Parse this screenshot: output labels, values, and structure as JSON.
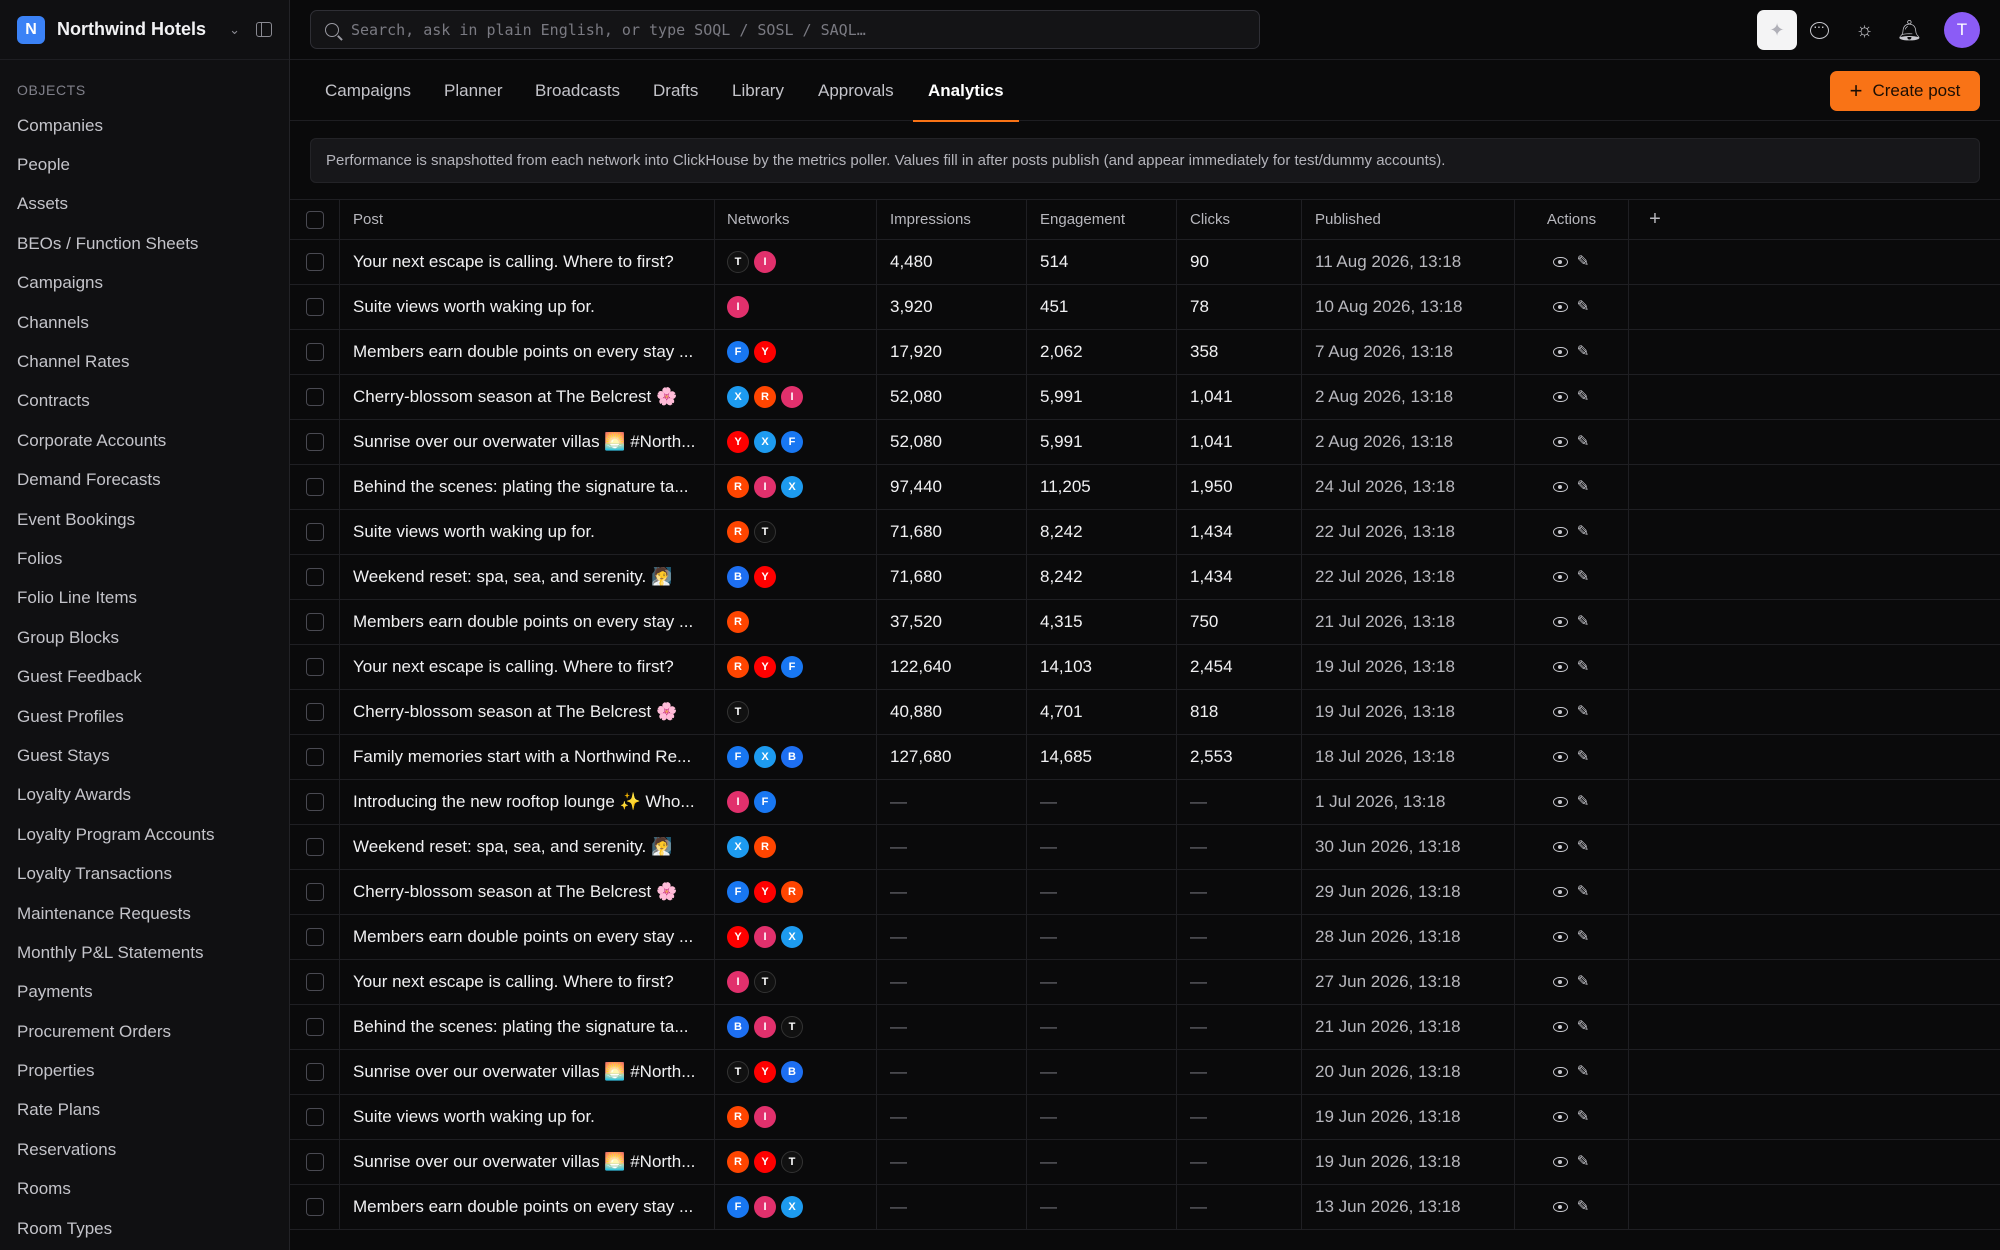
{
  "app": {
    "logo_letter": "N",
    "name": "Northwind Hotels"
  },
  "sidebar": {
    "section_label": "OBJECTS",
    "items": [
      "Companies",
      "People",
      "Assets",
      "BEOs / Function Sheets",
      "Campaigns",
      "Channels",
      "Channel Rates",
      "Contracts",
      "Corporate Accounts",
      "Demand Forecasts",
      "Event Bookings",
      "Folios",
      "Folio Line Items",
      "Group Blocks",
      "Guest Feedback",
      "Guest Profiles",
      "Guest Stays",
      "Loyalty Awards",
      "Loyalty Program Accounts",
      "Loyalty Transactions",
      "Maintenance Requests",
      "Monthly P&L Statements",
      "Payments",
      "Procurement Orders",
      "Properties",
      "Rate Plans",
      "Reservations",
      "Rooms",
      "Room Types"
    ]
  },
  "search": {
    "placeholder": "Search, ask in plain English, or type SOQL / SOSL / SAQL…"
  },
  "user": {
    "avatar_letter": "T"
  },
  "tabs": [
    "Campaigns",
    "Planner",
    "Broadcasts",
    "Drafts",
    "Library",
    "Approvals",
    "Analytics"
  ],
  "active_tab": "Analytics",
  "create_button": "Create post",
  "info_text": "Performance is snapshotted from each network into ClickHouse by the metrics poller. Values fill in after posts publish (and appear immediately for test/dummy accounts).",
  "columns": {
    "post": "Post",
    "networks": "Networks",
    "impressions": "Impressions",
    "engagement": "Engagement",
    "clicks": "Clicks",
    "published": "Published",
    "actions": "Actions",
    "add": "+"
  },
  "network_colors": {
    "T": "#111111",
    "I": "#e1306c",
    "F": "#1877f2",
    "Y": "#ff0000",
    "X": "#1d9bf0",
    "R": "#ff4500",
    "B": "#1d6ff2"
  },
  "rows": [
    {
      "post": "Your next escape is calling. Where to first?",
      "networks": [
        "T",
        "I"
      ],
      "impressions": "4,480",
      "engagement": "514",
      "clicks": "90",
      "published": "11 Aug 2026, 13:18"
    },
    {
      "post": "Suite views worth waking up for.",
      "networks": [
        "I"
      ],
      "impressions": "3,920",
      "engagement": "451",
      "clicks": "78",
      "published": "10 Aug 2026, 13:18"
    },
    {
      "post": "Members earn double points on every stay ...",
      "networks": [
        "F",
        "Y"
      ],
      "impressions": "17,920",
      "engagement": "2,062",
      "clicks": "358",
      "published": "7 Aug 2026, 13:18"
    },
    {
      "post": "Cherry-blossom season at The Belcrest 🌸",
      "networks": [
        "X",
        "R",
        "I"
      ],
      "impressions": "52,080",
      "engagement": "5,991",
      "clicks": "1,041",
      "published": "2 Aug 2026, 13:18"
    },
    {
      "post": "Sunrise over our overwater villas 🌅 #North...",
      "networks": [
        "Y",
        "X",
        "F"
      ],
      "impressions": "52,080",
      "engagement": "5,991",
      "clicks": "1,041",
      "published": "2 Aug 2026, 13:18"
    },
    {
      "post": "Behind the scenes: plating the signature ta...",
      "networks": [
        "R",
        "I",
        "X"
      ],
      "impressions": "97,440",
      "engagement": "11,205",
      "clicks": "1,950",
      "published": "24 Jul 2026, 13:18"
    },
    {
      "post": "Suite views worth waking up for.",
      "networks": [
        "R",
        "T"
      ],
      "impressions": "71,680",
      "engagement": "8,242",
      "clicks": "1,434",
      "published": "22 Jul 2026, 13:18"
    },
    {
      "post": "Weekend reset: spa, sea, and serenity. 🧖",
      "networks": [
        "B",
        "Y"
      ],
      "impressions": "71,680",
      "engagement": "8,242",
      "clicks": "1,434",
      "published": "22 Jul 2026, 13:18"
    },
    {
      "post": "Members earn double points on every stay ...",
      "networks": [
        "R"
      ],
      "impressions": "37,520",
      "engagement": "4,315",
      "clicks": "750",
      "published": "21 Jul 2026, 13:18"
    },
    {
      "post": "Your next escape is calling. Where to first?",
      "networks": [
        "R",
        "Y",
        "F"
      ],
      "impressions": "122,640",
      "engagement": "14,103",
      "clicks": "2,454",
      "published": "19 Jul 2026, 13:18"
    },
    {
      "post": "Cherry-blossom season at The Belcrest 🌸",
      "networks": [
        "T"
      ],
      "impressions": "40,880",
      "engagement": "4,701",
      "clicks": "818",
      "published": "19 Jul 2026, 13:18"
    },
    {
      "post": "Family memories start with a Northwind Re...",
      "networks": [
        "F",
        "X",
        "B"
      ],
      "impressions": "127,680",
      "engagement": "14,685",
      "clicks": "2,553",
      "published": "18 Jul 2026, 13:18"
    },
    {
      "post": "Introducing the new rooftop lounge ✨ Who...",
      "networks": [
        "I",
        "F"
      ],
      "impressions": "—",
      "engagement": "—",
      "clicks": "—",
      "published": "1 Jul 2026, 13:18"
    },
    {
      "post": "Weekend reset: spa, sea, and serenity. 🧖",
      "networks": [
        "X",
        "R"
      ],
      "impressions": "—",
      "engagement": "—",
      "clicks": "—",
      "published": "30 Jun 2026, 13:18"
    },
    {
      "post": "Cherry-blossom season at The Belcrest 🌸",
      "networks": [
        "F",
        "Y",
        "R"
      ],
      "impressions": "—",
      "engagement": "—",
      "clicks": "—",
      "published": "29 Jun 2026, 13:18"
    },
    {
      "post": "Members earn double points on every stay ...",
      "networks": [
        "Y",
        "I",
        "X"
      ],
      "impressions": "—",
      "engagement": "—",
      "clicks": "—",
      "published": "28 Jun 2026, 13:18"
    },
    {
      "post": "Your next escape is calling. Where to first?",
      "networks": [
        "I",
        "T"
      ],
      "impressions": "—",
      "engagement": "—",
      "clicks": "—",
      "published": "27 Jun 2026, 13:18"
    },
    {
      "post": "Behind the scenes: plating the signature ta...",
      "networks": [
        "B",
        "I",
        "T"
      ],
      "impressions": "—",
      "engagement": "—",
      "clicks": "—",
      "published": "21 Jun 2026, 13:18"
    },
    {
      "post": "Sunrise over our overwater villas 🌅 #North...",
      "networks": [
        "T",
        "Y",
        "B"
      ],
      "impressions": "—",
      "engagement": "—",
      "clicks": "—",
      "published": "20 Jun 2026, 13:18"
    },
    {
      "post": "Suite views worth waking up for.",
      "networks": [
        "R",
        "I"
      ],
      "impressions": "—",
      "engagement": "—",
      "clicks": "—",
      "published": "19 Jun 2026, 13:18"
    },
    {
      "post": "Sunrise over our overwater villas 🌅 #North...",
      "networks": [
        "R",
        "Y",
        "T"
      ],
      "impressions": "—",
      "engagement": "—",
      "clicks": "—",
      "published": "19 Jun 2026, 13:18"
    },
    {
      "post": "Members earn double points on every stay ...",
      "networks": [
        "F",
        "I",
        "X"
      ],
      "impressions": "—",
      "engagement": "—",
      "clicks": "—",
      "published": "13 Jun 2026, 13:18"
    }
  ]
}
